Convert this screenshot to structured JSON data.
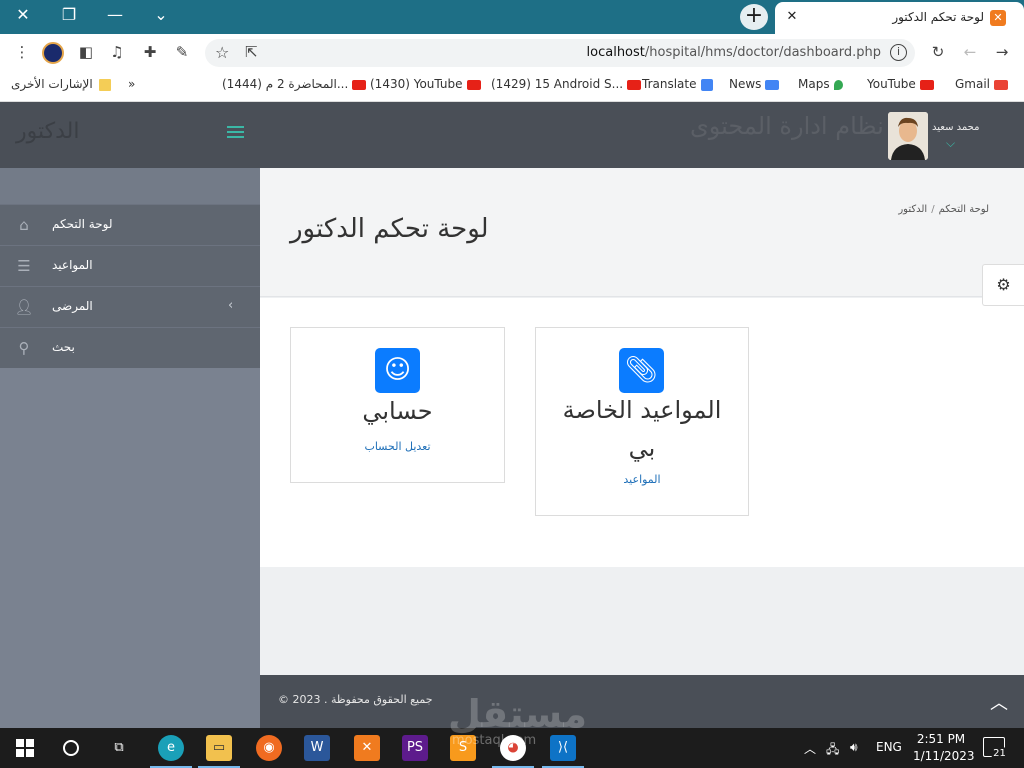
{
  "browser": {
    "tab_title": "لوحة تحكم الدكتور",
    "url_host": "localhost",
    "url_path": "/hospital/hms/doctor/dashboard.php",
    "window_close": "✕",
    "window_restore": "❐",
    "window_minimize": "—",
    "tab_search": "⌄",
    "new_tab": "+"
  },
  "bookmarks": [
    {
      "label": "Gmail"
    },
    {
      "label": "YouTube"
    },
    {
      "label": "Maps"
    },
    {
      "label": "News"
    },
    {
      "label": "Translate"
    },
    {
      "label": "(1429) 15 Android S..."
    },
    {
      "label": "(1430) YouTube"
    },
    {
      "label": "(1444) المحاضرة 2 م..."
    },
    {
      "label": "»"
    },
    {
      "label": "الإشارات الأخرى"
    }
  ],
  "header": {
    "brand": "الدكتور",
    "system_title": "نظام ادارة المحتوى",
    "user_name": "محمد سعيد"
  },
  "sidebar": {
    "items": [
      {
        "label": "لوحة التحكم",
        "icon": "home-icon"
      },
      {
        "label": "المواعيد",
        "icon": "list-icon"
      },
      {
        "label": "المرضى",
        "icon": "user-icon"
      },
      {
        "label": "بحث",
        "icon": "search-icon"
      }
    ]
  },
  "main": {
    "breadcrumb_current": "الدكتور",
    "breadcrumb_root": "لوحة التحكم",
    "page_title": "لوحة تحكم الدكتور",
    "cards": [
      {
        "title": "حسابي",
        "link": "تعديل الحساب",
        "icon": "smile-icon"
      },
      {
        "title_line1": "المواعيد الخاصة",
        "title_line2": "بي",
        "link": "المواعيد",
        "icon": "paperclip-icon"
      }
    ]
  },
  "footer": {
    "copyright": "جميع الحقوق محفوظة . 2023 ©"
  },
  "watermark": {
    "text": "مستقل",
    "sub": "mostaql.com"
  },
  "taskbar": {
    "language": "ENG",
    "time": "2:51 PM",
    "date": "1/11/2023",
    "notifications": "21"
  },
  "colors": {
    "accent_blue": "#0b7cff",
    "header_bg": "#4a4f57",
    "sidebar_bg": "#7a8290",
    "teal": "#3bb8a6"
  }
}
